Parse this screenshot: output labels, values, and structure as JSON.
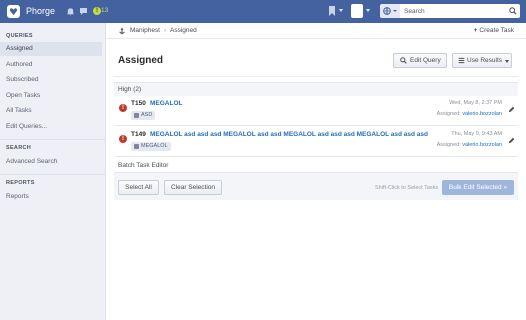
{
  "topbar": {
    "app_name": "Phorge",
    "notification_count": "13",
    "search_placeholder": "Search",
    "icons": [
      "phorge-logo-icon",
      "bell-icon",
      "chat-icon",
      "alert-icon",
      "bookmark-icon",
      "avatar",
      "globe-icon",
      "search-icon"
    ]
  },
  "sidebar": {
    "queries_heading": "QUERIES",
    "queries": [
      {
        "label": "Assigned",
        "active": true
      },
      {
        "label": "Authored"
      },
      {
        "label": "Subscribed"
      },
      {
        "label": "Open Tasks"
      },
      {
        "label": "All Tasks"
      },
      {
        "label": "Edit Queries..."
      }
    ],
    "search_heading": "SEARCH",
    "search_items": [
      {
        "label": "Advanced Search"
      }
    ],
    "reports_heading": "REPORTS",
    "reports_items": [
      {
        "label": "Reports"
      }
    ]
  },
  "breadcrumb": {
    "app": "Maniphest",
    "separator": "›",
    "current": "Assigned",
    "create_task": "Create Task"
  },
  "main": {
    "title": "Assigned",
    "edit_query": "Edit Query",
    "use_results": "Use Results",
    "group_label": "High (2)",
    "tasks": [
      {
        "id": "T150",
        "name": "MEGALOL",
        "tag": "ASD",
        "date": "Wed, May 8, 2:37 PM",
        "assigned_label": "Assigned:",
        "assignee": "valerio.bozzolan"
      },
      {
        "id": "T149",
        "name": "MEGALOL asd asd asd MEGALOL asd asd MEGALOL asd asd asd MEGALOL asd asd asd",
        "tag": "MEGALOL",
        "date": "Thu, May 9, 9:43 AM",
        "assigned_label": "Assigned:",
        "assignee": "valerio.bozzolan"
      }
    ],
    "priority_color": "#c0392b",
    "batch_title": "Batch Task Editor",
    "select_all": "Select All",
    "clear_selection": "Clear Selection",
    "shift_hint": "Shift-Click to Select Tasks",
    "bulk_edit": "Bulk Edit Selected »"
  }
}
